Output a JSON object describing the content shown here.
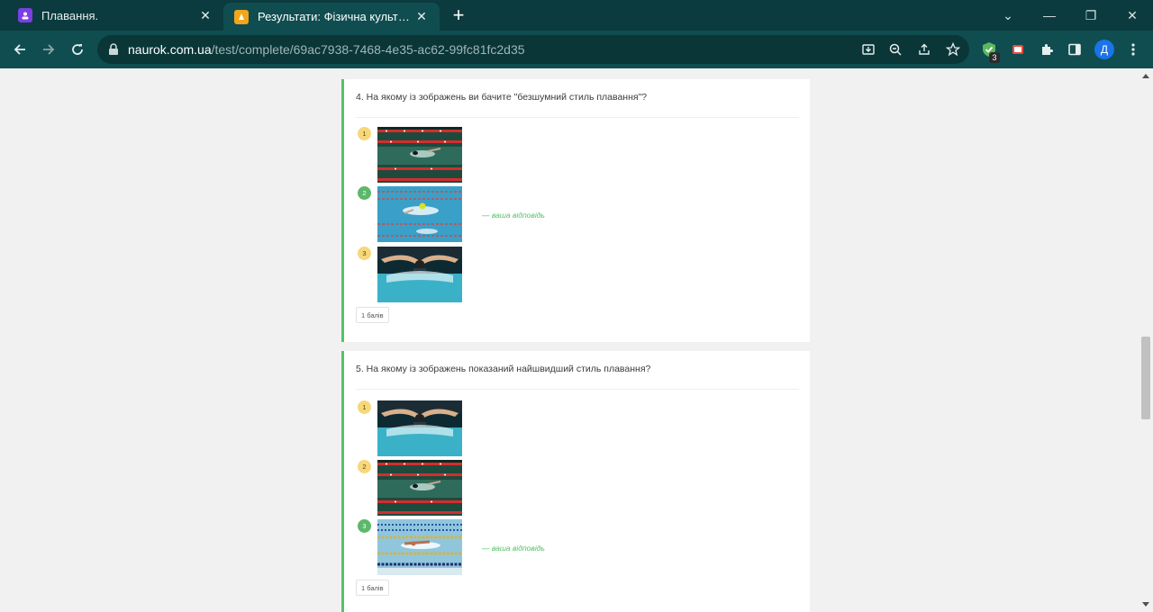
{
  "browser": {
    "tabs": [
      {
        "title": "Плавання.",
        "active": false,
        "icon": "classroom-icon"
      },
      {
        "title": "Результати: Фізична культура.M",
        "active": true,
        "icon": "naurok-icon"
      }
    ],
    "url_host": "naurok.com.ua",
    "url_path": "/test/complete/69ac7938-7468-4e35-ac62-99fc81fc2d35",
    "extension_badge": "3",
    "profile_initial": "Д"
  },
  "questions": [
    {
      "text": "4. На якому із зображень ви бачите \"безшумний стиль плавання\"?",
      "options": [
        {
          "number": "1",
          "status": "yellow",
          "image": "freestyle-lanes-red"
        },
        {
          "number": "2",
          "status": "green",
          "image": "breaststroke-blue",
          "answer_label": "— ваша відповідь"
        },
        {
          "number": "3",
          "status": "yellow",
          "image": "butterfly-stroke"
        }
      ],
      "points": "1 балів"
    },
    {
      "text": "5. На якому із зображень показаний найшвидший стиль плавання?",
      "options": [
        {
          "number": "1",
          "status": "yellow",
          "image": "butterfly-stroke"
        },
        {
          "number": "2",
          "status": "yellow",
          "image": "freestyle-lanes-red"
        },
        {
          "number": "3",
          "status": "green",
          "image": "freestyle-lanes-gold",
          "answer_label": "— ваша відповідь"
        }
      ],
      "points": "1 балів"
    }
  ],
  "colors": {
    "correct_accent": "#55c265",
    "toolbar": "#104d50",
    "tabbar": "#0b3b3e"
  }
}
